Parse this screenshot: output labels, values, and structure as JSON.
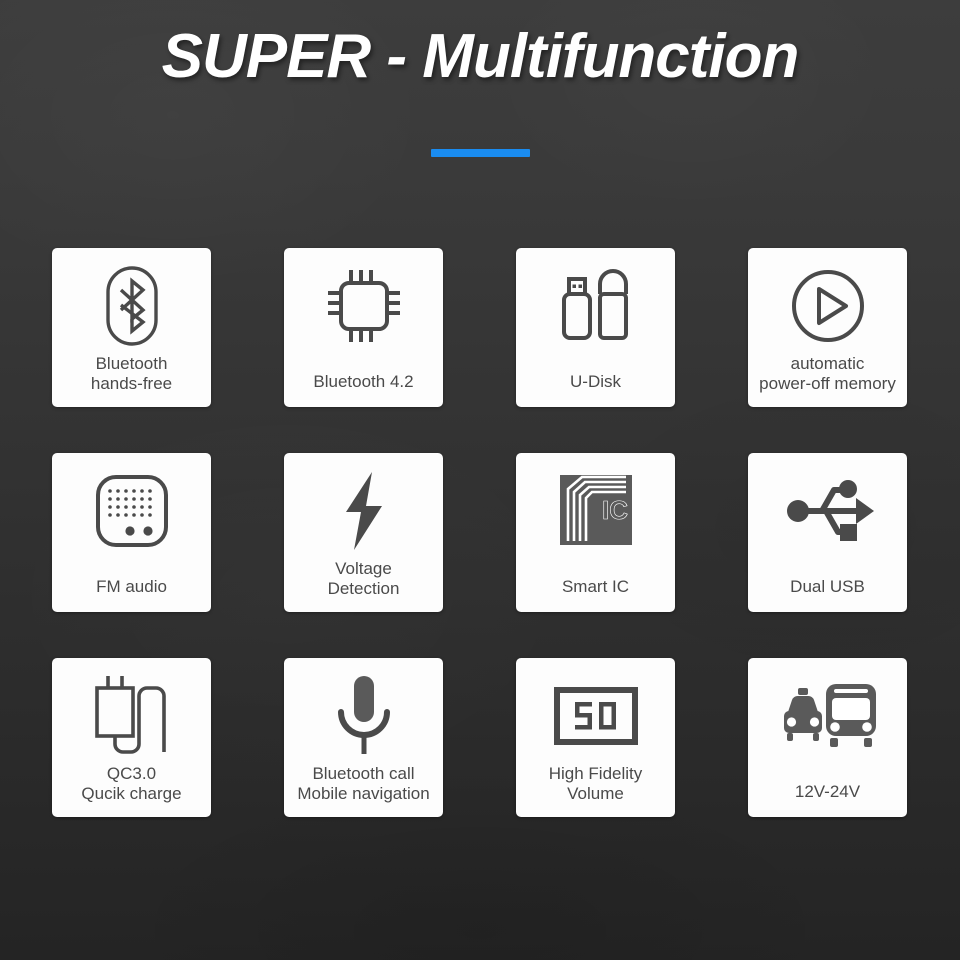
{
  "header": {
    "title": "SUPER - Multifunction",
    "accent_color": "#1a8cf0",
    "title_color": "#ffffff"
  },
  "background": {
    "color_top": "#3d3d3d",
    "color_bottom": "#242424"
  },
  "features": {
    "card_background": "#fdfdfd",
    "icon_color": "#4a4a4a",
    "label_color": "#4a4a4a",
    "items": [
      {
        "label": "Bluetooth\nhands-free",
        "icon": "bluetooth-icon"
      },
      {
        "label": "Bluetooth 4.2",
        "icon": "chip-icon"
      },
      {
        "label": "U-Disk",
        "icon": "usb-flash-drive-icon"
      },
      {
        "label": "automatic\npower-off memory",
        "icon": "play-circle-icon"
      },
      {
        "label": "FM audio",
        "icon": "radio-speaker-icon"
      },
      {
        "label": "Voltage\nDetection",
        "icon": "lightning-bolt-icon"
      },
      {
        "label": "Smart IC",
        "icon": "smart-ic-chip-icon"
      },
      {
        "label": "Dual USB",
        "icon": "usb-trident-icon"
      },
      {
        "label": "QC3.0\nQucik charge",
        "icon": "wall-charger-icon"
      },
      {
        "label": "Bluetooth call\nMobile navigation",
        "icon": "microphone-icon"
      },
      {
        "label": "High Fidelity\nVolume",
        "icon": "volume-display-50-icon",
        "display_value": "50"
      },
      {
        "label": "12V-24V",
        "icon": "taxi-bus-icon"
      }
    ]
  }
}
